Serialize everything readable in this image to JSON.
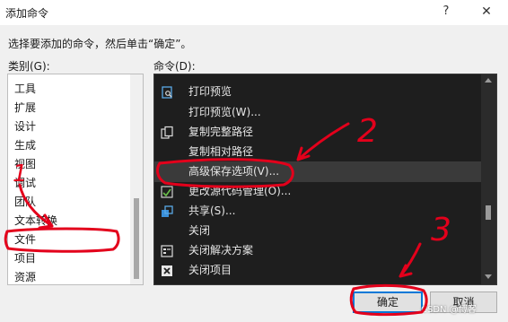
{
  "window": {
    "title": "添加命令",
    "help": "?",
    "close": "✕"
  },
  "instruction": "选择要添加的命令，然后单击“确定”。",
  "categories": {
    "label": "类别(G):",
    "items": [
      "工具",
      "扩展",
      "设计",
      "生成",
      "视图",
      "调试",
      "团队",
      "文本转换",
      "文件",
      "项目",
      "资源"
    ]
  },
  "commands": {
    "label": "命令(D):",
    "items": [
      {
        "label": "打印预览",
        "icon": "print-preview-icon"
      },
      {
        "label": "打印预览(W)...",
        "icon": ""
      },
      {
        "label": "复制完整路径",
        "icon": "copy-icon"
      },
      {
        "label": "复制相对路径",
        "icon": ""
      },
      {
        "label": "高级保存选项(V)...",
        "icon": "",
        "selected": true
      },
      {
        "label": "更改源代码管理(O)...",
        "icon": "source-control-icon"
      },
      {
        "label": "共享(S)...",
        "icon": "share-icon"
      },
      {
        "label": "关闭",
        "icon": ""
      },
      {
        "label": "关闭解决方案",
        "icon": "close-solution-icon"
      },
      {
        "label": "关闭项目",
        "icon": "close-project-icon"
      }
    ]
  },
  "buttons": {
    "ok": "确定",
    "cancel": "取消"
  },
  "annotations": {
    "mark1": "1",
    "mark2": "2",
    "mark3": "3",
    "color": "#e3001b"
  },
  "watermark": "CSDN @博客"
}
